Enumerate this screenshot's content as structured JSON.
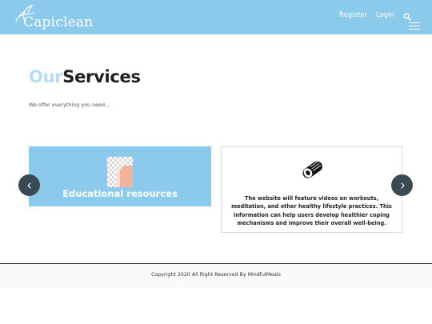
{
  "header": {
    "logo_text": "Capiclean",
    "nav": {
      "register": "Register",
      "login": "Login"
    },
    "icons": {
      "search": "search-icon",
      "menu": "hamburger-menu-icon"
    },
    "colors": {
      "background": "#8ccaec",
      "text": "#ffffff"
    }
  },
  "services": {
    "heading_prefix": "Our",
    "heading_main": "Services",
    "subtitle": "We offer everything you need...",
    "cards": [
      {
        "title": "Educational resources",
        "icon": "image-placeholder-icon"
      },
      {
        "icon": "yoga-mat-icon",
        "description": "The website will feature videos on workouts, meditation, and other healthy lifestyle practices. This information can help users develop healthier coping mechanisms and improve their overall well-being."
      }
    ],
    "carousel": {
      "prev_icon": "chevron-left-icon",
      "next_icon": "chevron-right-icon"
    }
  },
  "footer": {
    "copyright": "Copyright 2020 All Right Reserved By MindfulMeals"
  }
}
